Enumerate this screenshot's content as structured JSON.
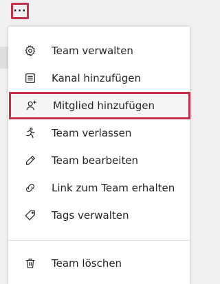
{
  "more_button": {
    "label": "···"
  },
  "menu": {
    "items": [
      {
        "label": "Team verwalten",
        "icon": "gear-icon"
      },
      {
        "label": "Kanal hinzufügen",
        "icon": "channel-list-icon"
      },
      {
        "label": "Mitglied hinzufügen",
        "icon": "add-person-icon"
      },
      {
        "label": "Team verlassen",
        "icon": "leave-icon"
      },
      {
        "label": "Team bearbeiten",
        "icon": "pencil-icon"
      },
      {
        "label": "Link zum Team erhalten",
        "icon": "link-icon"
      },
      {
        "label": "Tags verwalten",
        "icon": "tag-icon"
      },
      {
        "label": "Team löschen",
        "icon": "trash-icon"
      }
    ]
  },
  "colors": {
    "highlight_border": "#c4314b",
    "text": "#252423"
  }
}
